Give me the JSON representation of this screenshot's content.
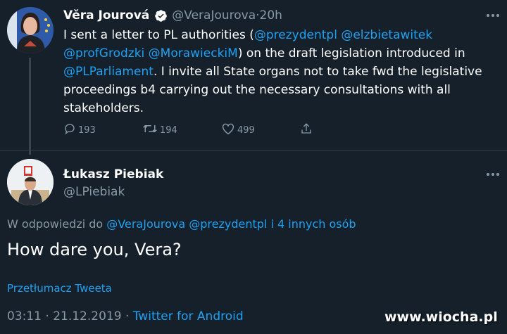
{
  "colors": {
    "background": "#15202b",
    "text": "#ffffff",
    "muted": "#8899a6",
    "link": "#1da1f2",
    "divider": "#38444d",
    "verified": "#ffffff"
  },
  "tweet": {
    "author_name": "Věra Jourová",
    "author_handle": "@VeraJourova",
    "separator": "·",
    "time": "20h",
    "verified_icon": "verified-badge-icon",
    "more_icon": "more-dots-icon",
    "text_parts": [
      {
        "t": "I sent a letter to PL authorities ("
      },
      {
        "t": "@prezydentpl",
        "mention": true
      },
      {
        "t": " "
      },
      {
        "t": "@elzbietawitek",
        "mention": true
      },
      {
        "t": " "
      },
      {
        "t": "@profGrodzki",
        "mention": true
      },
      {
        "t": " "
      },
      {
        "t": "@MorawieckiM",
        "mention": true
      },
      {
        "t": ") on the draft legislation introduced in "
      },
      {
        "t": "@PLParliament",
        "mention": true
      },
      {
        "t": ". I invite all State organs not to take fwd the legislative proceedings b4 carrying out the necessary consultations with all stakeholders."
      }
    ],
    "actions": {
      "reply_count": "193",
      "retweet_count": "194",
      "like_count": "499",
      "reply_icon": "reply-icon",
      "retweet_icon": "retweet-icon",
      "like_icon": "heart-icon",
      "share_icon": "share-icon"
    }
  },
  "reply": {
    "author_name": "Łukasz Piebiak",
    "author_handle": "@LPiebiak",
    "more_icon": "more-dots-icon",
    "replying_prefix": "W odpowiedzi do ",
    "replying_mentions": "@VeraJourova @prezydentpl",
    "replying_others": " i 4 innych osób",
    "text": "How dare you, Vera?",
    "translate_label": "Przetłumacz Tweeta",
    "timestamp": "03:11 · 21.12.2019 · ",
    "client": "Twitter for Android"
  },
  "watermark": "www.wiocha.pl"
}
